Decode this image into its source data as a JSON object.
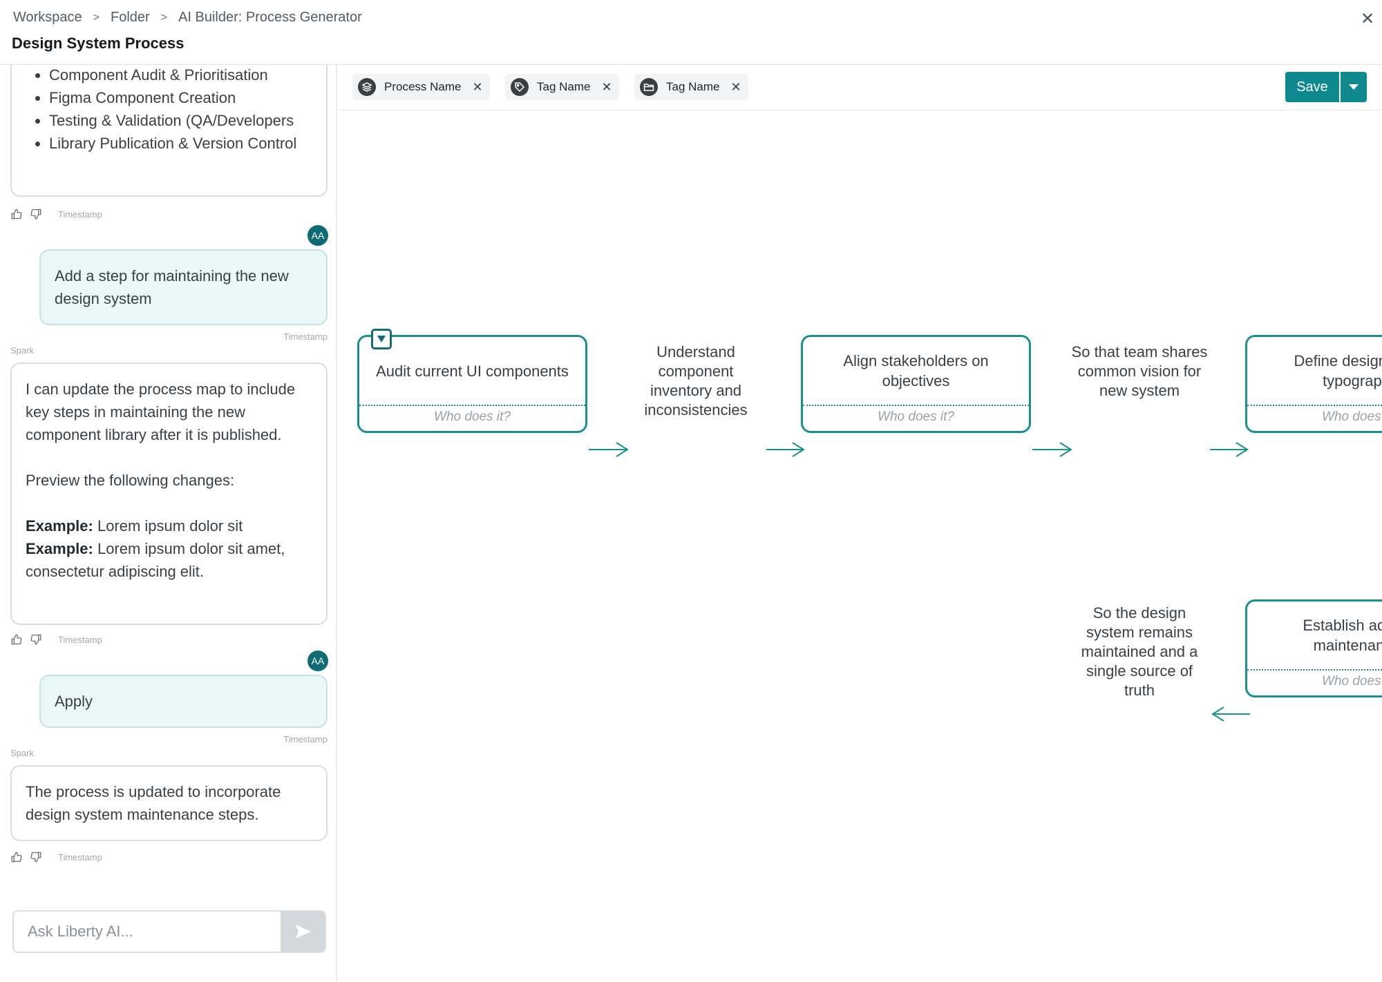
{
  "header": {
    "breadcrumb": [
      "Workspace",
      "Folder",
      "AI Builder: Process Generator"
    ],
    "title": "Design System Process"
  },
  "chat": {
    "list_items": [
      "Component Audit & Prioritisation",
      "Figma Component Creation",
      "Testing & Validation (QA/Developers",
      "Library Publication & Version Control"
    ],
    "timestamp_label": "Timestamp",
    "user_initials": "AA",
    "user_message_1": "Add a step for maintaining the new design system",
    "sender_name": "Spark",
    "ai_message_1": {
      "intro": "I can update the process map to include key steps in maintaining the new component library after it is published.",
      "preview": "Preview the following changes:",
      "example_label": "Example:",
      "example_1": "Lorem ipsum dolor sit",
      "example_2": "Lorem ipsum dolor sit amet, consectetur adipiscing elit."
    },
    "user_message_2": "Apply",
    "ai_message_2": "The process is updated to incorporate design system maintenance steps.",
    "composer_placeholder": "Ask Liberty AI..."
  },
  "toolbar": {
    "chips": [
      {
        "label": "Process Name",
        "icon": "layers-icon"
      },
      {
        "label": "Tag Name",
        "icon": "tag-icon"
      },
      {
        "label": "Tag Name",
        "icon": "folder-icon"
      }
    ],
    "save_label": "Save"
  },
  "process_map": {
    "who_placeholder": "Who does it?",
    "steps": [
      {
        "title": "Audit current UI components"
      },
      {
        "title": "Align stakeholders on objectives"
      },
      {
        "title": "Define design tok… typography"
      },
      {
        "title": "Establish adop… maintenanc…"
      }
    ],
    "outcomes": [
      "Understand component inventory and inconsistencies",
      "So that team shares common vision for new system",
      "So the design system remains maintained and a single source of truth"
    ]
  },
  "colors": {
    "accent": "#0e8a8e",
    "node_border": "#1a8f8f",
    "avatar": "#0e6b73",
    "user_bubble": "#eaf7f7"
  }
}
